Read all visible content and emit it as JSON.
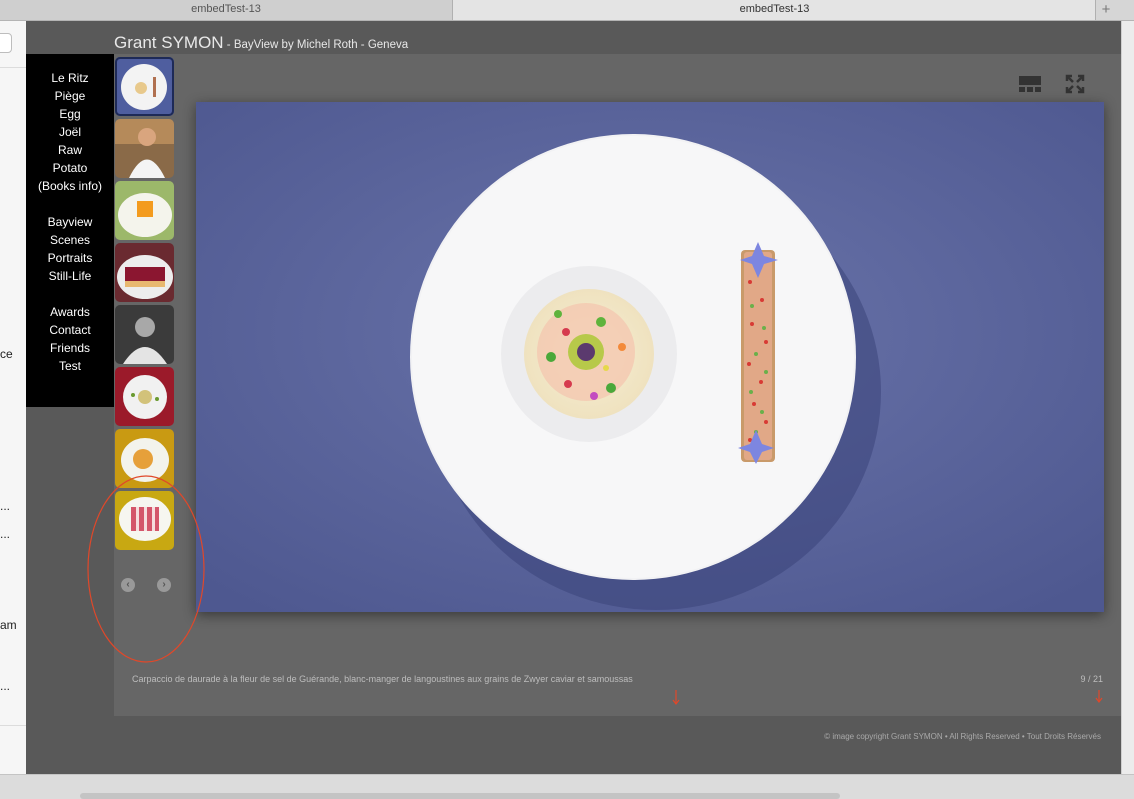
{
  "browser": {
    "tabs": [
      {
        "label": "embedTest-13"
      },
      {
        "label": "embedTest-13"
      }
    ],
    "new_tab_label": "+"
  },
  "side_fragments": [
    "ce",
    "...",
    "...",
    "am",
    "..."
  ],
  "site": {
    "title_main": "Grant SYMON",
    "title_sub": " - ",
    "title_subtitle": "BayView by Michel Roth - Geneva"
  },
  "menu": {
    "group1": [
      "Le Ritz",
      "Piège",
      "Egg",
      "Joël",
      "Raw",
      "Potato",
      "(Books info)"
    ],
    "group2": [
      "Bayview",
      "Scenes",
      "Portraits",
      "Still-Life"
    ],
    "group3": [
      "Awards",
      "Contact",
      "Friends",
      "Test"
    ]
  },
  "gallery": {
    "caption": "Carpaccio de daurade à la fleur de sel de Guérande, blanc-manger de langoustines aux grains de Zwyer caviar et samoussas",
    "counter": "9 / 21",
    "current_index": 9,
    "total": 21,
    "thumbnails": [
      "plate-small-white",
      "chef-portrait",
      "orange-dessert",
      "red-tart",
      "chef-bw-portrait",
      "red-plate",
      "yellow-plate",
      "stripe-dessert"
    ],
    "prev_icon": "chevron-left-icon",
    "next_icon": "chevron-right-icon",
    "toolbar_icons": [
      "thumbnail-strip-icon",
      "fullscreen-icon"
    ]
  },
  "footer": {
    "copyright": "© image copyright Grant SYMON • All Rights Reserved • Tout Droits Réservés"
  },
  "colors": {
    "stage": "#595959",
    "gallery": "#666666",
    "menu": "#000000",
    "photo_background": "#5a6499",
    "annotation": "#e0482a"
  }
}
